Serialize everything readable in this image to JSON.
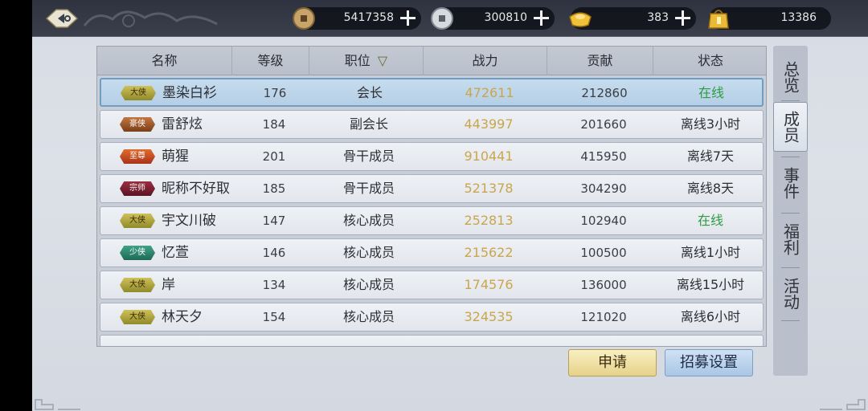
{
  "currencies": [
    {
      "name": "copper-coin-icon",
      "value": "5417358"
    },
    {
      "name": "silver-coin-icon",
      "value": "300810"
    },
    {
      "name": "gold-ingot-icon",
      "value": "383"
    },
    {
      "name": "gift-bag-icon",
      "value": "13386"
    }
  ],
  "table": {
    "headers": [
      "名称",
      "等级",
      "职位",
      "战力",
      "贡献",
      "状态"
    ],
    "sort_indicator": "▽",
    "rows": [
      {
        "badge": "大侠",
        "badge_type": "daxia",
        "name": "墨染白衫",
        "level": "176",
        "position": "会长",
        "power": "472611",
        "contribution": "212860",
        "status": "在线",
        "online": true
      },
      {
        "badge": "豪侠",
        "badge_type": "haoxia",
        "name": "雷舒炫",
        "level": "184",
        "position": "副会长",
        "power": "443997",
        "contribution": "201660",
        "status": "离线3小时",
        "online": false
      },
      {
        "badge": "至尊",
        "badge_type": "zhizun",
        "name": "萌猩",
        "level": "201",
        "position": "骨干成员",
        "power": "910441",
        "contribution": "415950",
        "status": "离线7天",
        "online": false
      },
      {
        "badge": "宗师",
        "badge_type": "zongshi",
        "name": "昵称不好取",
        "level": "185",
        "position": "骨干成员",
        "power": "521378",
        "contribution": "304290",
        "status": "离线8天",
        "online": false
      },
      {
        "badge": "大侠",
        "badge_type": "daxia",
        "name": "宇文川破",
        "level": "147",
        "position": "核心成员",
        "power": "252813",
        "contribution": "102940",
        "status": "在线",
        "online": true
      },
      {
        "badge": "少侠",
        "badge_type": "shaoxia",
        "name": "忆萱",
        "level": "146",
        "position": "核心成员",
        "power": "215622",
        "contribution": "100500",
        "status": "离线1小时",
        "online": false
      },
      {
        "badge": "大侠",
        "badge_type": "daxia",
        "name": "岸",
        "level": "134",
        "position": "核心成员",
        "power": "174576",
        "contribution": "136000",
        "status": "离线15小时",
        "online": false
      },
      {
        "badge": "大侠",
        "badge_type": "daxia",
        "name": "林天夕",
        "level": "154",
        "position": "核心成员",
        "power": "324535",
        "contribution": "121020",
        "status": "离线6小时",
        "online": false
      }
    ]
  },
  "side_tabs": [
    "总览",
    "成员",
    "事件",
    "福利",
    "活动"
  ],
  "active_tab": 1,
  "buttons": {
    "apply": "申请",
    "recruit_settings": "招募设置"
  },
  "colors": {
    "online": "#2f9a43",
    "power": "#c9a64e",
    "selected_row": "#c6dcee"
  }
}
